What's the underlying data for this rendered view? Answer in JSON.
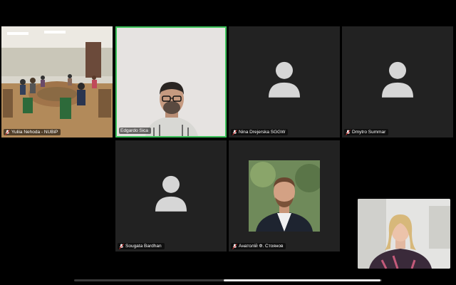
{
  "participants": [
    {
      "name": "Yuliia Nehoda - NUBiP",
      "video": "conference-room"
    },
    {
      "name": "Edgardo Sica",
      "video": "man-with-glasses",
      "active_speaker": true
    },
    {
      "name": "Nina Drejerska SGGW",
      "video": "avatar-icon"
    },
    {
      "name": "Dmytro Summar",
      "video": "avatar-icon"
    },
    {
      "name": "Sougata Bardhan",
      "video": "avatar-icon"
    },
    {
      "name": "Анатолій Ф. Стоянов",
      "video": "portrait-photo"
    }
  ],
  "self_view": {
    "video": "woman-self-view"
  },
  "colors": {
    "active_border": "#3cc15a",
    "tile_bg": "#222222"
  }
}
